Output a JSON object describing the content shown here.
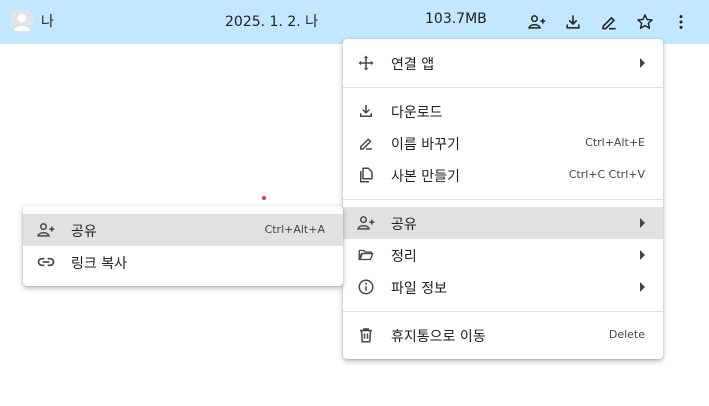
{
  "file_row": {
    "owner": "나",
    "date": "2025. 1. 2. 나",
    "size": "103.7MB",
    "actions": [
      "share-icon",
      "download-icon",
      "rename-icon",
      "star-icon",
      "more-vert-icon"
    ]
  },
  "context_menu": {
    "items": [
      {
        "label": "연결 앱",
        "shortcut": "",
        "icon": "move-arrows-icon"
      },
      {
        "label": "다운로드",
        "shortcut": "",
        "icon": "download-icon"
      },
      {
        "label": "이름 바꾸기",
        "shortcut": "Ctrl+Alt+E",
        "icon": "rename-icon"
      },
      {
        "label": "사본 만들기",
        "shortcut": "Ctrl+C Ctrl+V",
        "icon": "copy-icon"
      },
      {
        "label": "공유",
        "shortcut": "",
        "icon": "person-add-icon"
      },
      {
        "label": "정리",
        "shortcut": "",
        "icon": "folder-open-icon"
      },
      {
        "label": "파일 정보",
        "shortcut": "",
        "icon": "info-icon"
      },
      {
        "label": "휴지통으로 이동",
        "shortcut": "Delete",
        "icon": "trash-icon"
      }
    ]
  },
  "share_submenu": {
    "items": [
      {
        "label": "공유",
        "shortcut": "Ctrl+Alt+A",
        "icon": "person-add-icon"
      },
      {
        "label": "링크 복사",
        "shortcut": "",
        "icon": "link-icon"
      }
    ]
  },
  "colors": {
    "selected_row": "#c2e7ff",
    "menu_hover": "#e1e1e1",
    "icon": "#444746"
  }
}
